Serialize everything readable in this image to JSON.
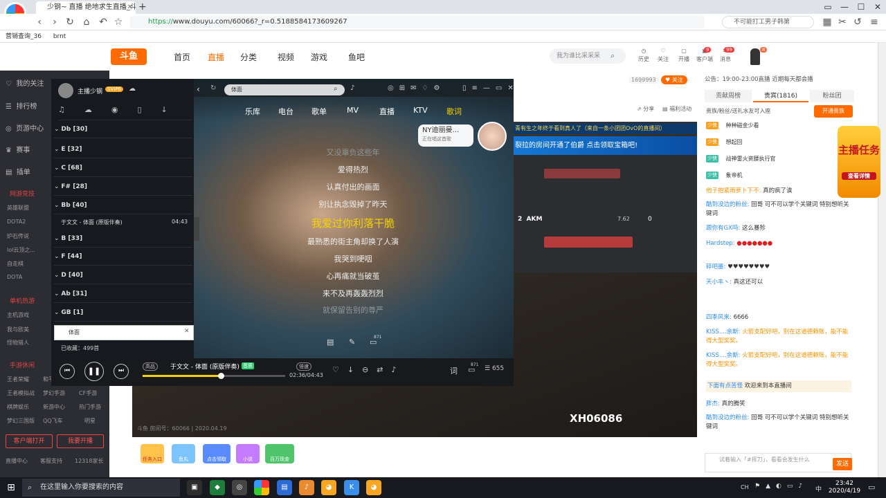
{
  "browser": {
    "tab_title": "少钢~ 直播 绝地求生直播_斗...",
    "url_prefix": "https://",
    "url_rest": "www.douyu.com/60066?_r=0.5188584173609267",
    "search_placeholder": "不可能打工男子韩第",
    "bookmarks": [
      "营销查询_36",
      "brnt"
    ],
    "new_tab": "+"
  },
  "header": {
    "logo": "斗鱼",
    "nav": [
      "首页",
      "直播",
      "分类",
      "视频",
      "游戏",
      "鱼吧"
    ],
    "search_placeholder": "我为谁比采采采",
    "icons": [
      "历史",
      "关注",
      "开播",
      "客户端",
      "消息"
    ],
    "notification_counts": [
      "9",
      "99"
    ],
    "user_badge": "8"
  },
  "sidebar": {
    "items": [
      "我的关注",
      "排行榜",
      "页游中心",
      "赛事",
      "插单"
    ],
    "section_online": "网游竞技",
    "online_games": [
      "英雄联盟",
      "DOTA2",
      "炉石传说",
      "lol云顶之...",
      "自走棋",
      "DOTA"
    ],
    "section_single": "单机热游",
    "single_games": [
      "主机游戏",
      "我与欧美",
      "怪物猎人"
    ],
    "section_mobile": "手游休闲",
    "mobile_games": [
      "王者荣耀",
      "和平精英",
      "王者模拟战",
      "梦幻手游",
      "CF手游",
      "棋牌娱乐",
      "新游中心",
      "热门手游",
      "梦幻三国版",
      "QQ飞车",
      "明星"
    ],
    "btn_client": "客户端打开",
    "btn_stream": "我要开播",
    "footer": [
      "直播中心",
      "客服支持",
      "12318家长"
    ]
  },
  "stream": {
    "follow_count": "1699993",
    "follow_label": "关注",
    "share": "分享",
    "report": "福利活动",
    "banner1": "青有生之年终于看到真人了（来自一条小团团OvO的直播间）",
    "banner2": "裂拉的房间开通了伯爵 点击领取宝箱吧!",
    "weapon_slot": "2",
    "weapon_name": "AKM",
    "ammo": "7.62",
    "ammo_count": "0",
    "overlay_id": "XH06086",
    "room_info": "斗鱼 房间号：60066 | 2020.04.19",
    "below_items": [
      "任务入口",
      "鱼丸",
      "点击领取",
      "小说",
      "百万现金"
    ]
  },
  "player": {
    "user": "主播少钢",
    "vip": "SVIP6",
    "search_value": "体面",
    "nav": [
      "乐库",
      "电台",
      "歌单",
      "MV",
      "直播",
      "KTV",
      "歌词"
    ],
    "active_nav": "歌词",
    "groups": [
      {
        "label": "Db [30]"
      },
      {
        "label": "E [32]"
      },
      {
        "label": "C [68]"
      },
      {
        "label": "F# [28]"
      },
      {
        "label": "Bb [40]"
      }
    ],
    "song_item": "于文文 - 体面 (原版伴奏)",
    "song_time": "04:43",
    "groups2": [
      {
        "label": "B [33]"
      },
      {
        "label": "F [44]"
      },
      {
        "label": "D [40]"
      },
      {
        "label": "Ab [31]"
      },
      {
        "label": "GB [1]"
      }
    ],
    "side_search": "体面",
    "collected": "已收藏：499首",
    "lyrics": [
      {
        "text": "又没辜负这些年",
        "style": "dim"
      },
      {
        "text": "爱得热烈",
        "style": "normal"
      },
      {
        "text": "认真付出的画面",
        "style": "normal"
      },
      {
        "text": "别让执念毁掉了昨天",
        "style": "normal"
      },
      {
        "text": "我爱过你利落干脆",
        "style": "cur"
      },
      {
        "text": "最熟悉的街主角却换了人演",
        "style": "normal"
      },
      {
        "text": "我哭到哽咽",
        "style": "normal"
      },
      {
        "text": "心再痛就当破茧",
        "style": "normal"
      },
      {
        "text": "来不及再轰轰烈烈",
        "style": "normal"
      },
      {
        "text": "就保留告别的尊严",
        "style": "dim"
      }
    ],
    "ny_name": "NY迪丽曼...",
    "ny_status": "正在唱这首歌",
    "now_playing": "于文文 - 体面 (原版伴奏)",
    "tag_quality": "高品",
    "tag_mode": "音质",
    "tag_speed": "倍速",
    "time": "02:36/04:43",
    "progress": 0.55,
    "comment_count": "871",
    "list_count": "655",
    "lyric_btn": "词"
  },
  "chat_panel": {
    "notice": "公告：19:00-23:00直播 近期每天都会播",
    "tabs": [
      "贡献周榜",
      "贵宾(1816)",
      "粉丝团"
    ],
    "active_tab": "贵宾(1816)",
    "vip_hint": "贵族/粉丝/送礼水友可入座",
    "vip_btn": "开通贵族",
    "ranks": [
      {
        "lvl": "少侠",
        "name": "种种磁金少看"
      },
      {
        "lvl": "少侠",
        "name": "想起回"
      },
      {
        "lvl": "少侠",
        "name": "战神雷火资腰执行官"
      },
      {
        "lvl": "少侠",
        "name": "象帝机"
      }
    ],
    "messages": [
      {
        "user": "他子抱紧雨萝卜下不:",
        "text": "真的疯了诶"
      },
      {
        "user": "酷到没边的粉丝:",
        "text": "回哥 可不可以学个关键词 特别想听关键词"
      },
      {
        "user": "跟你有GX吗:",
        "text": "这么暴殄"
      },
      {
        "user": "Hardstep:",
        "text": ""
      },
      {
        "user": "碎吧墨:",
        "text": "♥♥♥♥♥♥♥♥"
      },
      {
        "user": "天小丰ヽ:",
        "text": "真这还可以"
      },
      {
        "user": "四季风来:",
        "text": "6666"
      },
      {
        "user": "KISS....余斯:",
        "text": "火箭支配好吧，别在这道德赖账，能不能得大型奖奖。"
      },
      {
        "user": "KISS....余斯:",
        "text": "火箭支配好吧，别在这道德赖账，能不能得大型奖奖。"
      },
      {
        "user": "下面有点苦怪",
        "text": "欢迎来到本直播间"
      },
      {
        "user": "胖杰:",
        "text": "真的腾笑"
      },
      {
        "user": "酷到没边的粉丝:",
        "text": "回哥 可不可以学个关键词 特别想听关键词"
      }
    ],
    "input_placeholder": "试着输入「#挥刀」，看看会发生什么",
    "send": "发送",
    "task_label": "主播任务",
    "task_btn": "查看详情"
  },
  "taskbar": {
    "search_placeholder": "在这里输入你要搜索的内容",
    "time": "23:42",
    "date": "2020/4/19",
    "ime": "中",
    "tray_text": "CH"
  }
}
